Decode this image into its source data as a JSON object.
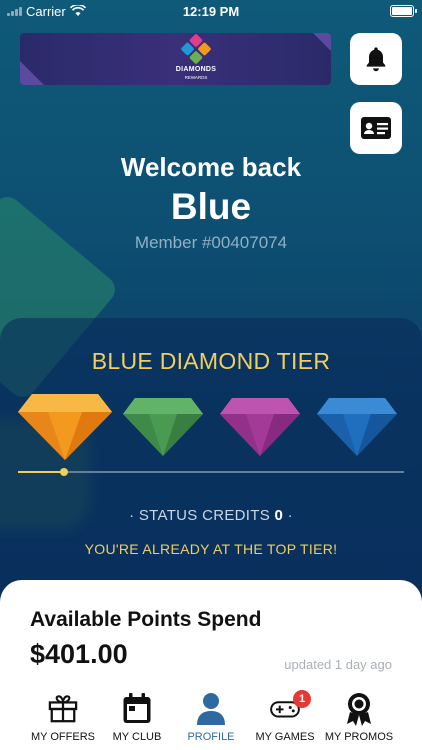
{
  "status_bar": {
    "carrier": "Carrier",
    "time": "12:19 PM"
  },
  "banner": {
    "logo_title": "DIAMONDS",
    "logo_subtitle": "REWARDS"
  },
  "header": {
    "welcome": "Welcome back",
    "name": "Blue",
    "member_number": "Member #00407074"
  },
  "tier": {
    "title": "BLUE DIAMOND TIER",
    "status_credits_label": "· STATUS CREDITS",
    "status_credits_value": "0",
    "status_credits_suffix": "·",
    "top_tier_message": "YOU'RE ALREADY AT THE TOP TIER!",
    "progress_fraction": 0.12,
    "gems": [
      {
        "name": "orange-gem",
        "color": "#f39a1e"
      },
      {
        "name": "green-gem",
        "color": "#4a9a52"
      },
      {
        "name": "purple-gem",
        "color": "#a43a98"
      },
      {
        "name": "blue-gem",
        "color": "#1e6fc0"
      }
    ]
  },
  "points": {
    "title": "Available Points Spend",
    "value": "$401.00",
    "updated": "updated 1 day ago"
  },
  "tabs": [
    {
      "label": "MY OFFERS",
      "icon": "gift-icon"
    },
    {
      "label": "MY CLUB",
      "icon": "calendar-icon"
    },
    {
      "label": "PROFILE",
      "icon": "person-icon",
      "active": true
    },
    {
      "label": "MY GAMES",
      "icon": "gamepad-icon",
      "badge": "1"
    },
    {
      "label": "MY PROMOS",
      "icon": "award-icon"
    }
  ],
  "colors": {
    "gold": "#f0cf60",
    "active_tab": "#2e6aa0",
    "badge": "#e53935"
  }
}
